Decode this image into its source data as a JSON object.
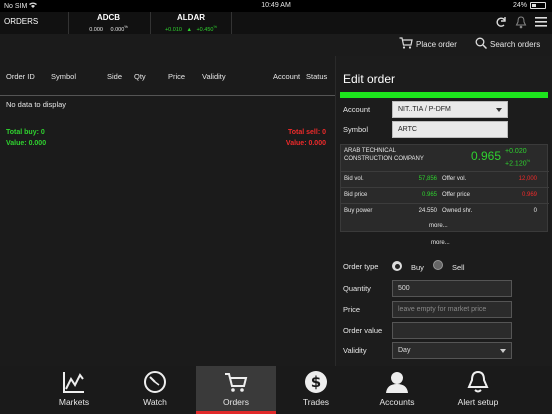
{
  "status": {
    "carrier": "No SIM",
    "time": "10:49 AM",
    "battery": "24%"
  },
  "header": {
    "title": "ORDERS",
    "tickers": [
      {
        "name": "ADCB",
        "v1": "0.000",
        "v2": "0.000",
        "pct": "%"
      },
      {
        "name": "ALDAR",
        "v1": "+0.010",
        "v2": "+0.450",
        "pct": "%"
      }
    ]
  },
  "actions": {
    "place_order": "Place order",
    "search_orders": "Search orders"
  },
  "table": {
    "columns": [
      "Order ID",
      "Symbol",
      "Side",
      "Qty",
      "Price",
      "Validity",
      "Account",
      "Status"
    ],
    "empty": "No data to display"
  },
  "totals": {
    "total_buy": "Total buy: 0",
    "value_buy": "Value: 0.000",
    "total_sell": "Total sell: 0",
    "value_sell": "Value: 0.000"
  },
  "edit": {
    "title": "Edit order",
    "account_label": "Account",
    "account_value": "NIT..TIA  / P-DFM",
    "symbol_label": "Symbol",
    "symbol_value": "ARTC",
    "quote": {
      "company": "ARAB TECHNICAL CONSTRUCTION COMPANY",
      "last": "0.965",
      "change": "+0.020",
      "change_pct": "+2.120",
      "pct": "%",
      "bid_vol_label": "Bid vol.",
      "bid_vol": "57,856",
      "offer_vol_label": "Offer vol.",
      "offer_vol": "12,000",
      "bid_price_label": "Bid price",
      "bid_price": "0.965",
      "offer_price_label": "Offer price",
      "offer_price": "0.969",
      "buy_power_label": "Buy power",
      "buy_power": "24.550",
      "owned_label": "Owned shr.",
      "owned": "0",
      "more1": "more...",
      "more2": "more..."
    },
    "order_type_label": "Order type",
    "buy": "Buy",
    "sell": "Sell",
    "quantity_label": "Quantity",
    "quantity_value": "500",
    "price_label": "Price",
    "price_placeholder": "leave empty for market price",
    "order_value_label": "Order value",
    "validity_label": "Validity",
    "validity_value": "Day"
  },
  "tabs": [
    {
      "label": "Markets",
      "icon": "chart-icon"
    },
    {
      "label": "Watch",
      "icon": "gauge-icon"
    },
    {
      "label": "Orders",
      "icon": "cart-icon"
    },
    {
      "label": "Trades",
      "icon": "dollar-icon"
    },
    {
      "label": "Accounts",
      "icon": "user-icon"
    },
    {
      "label": "Alert setup",
      "icon": "bell-icon"
    }
  ],
  "colors": {
    "accent_green": "#1de41d",
    "up": "#2fd22f",
    "down": "#ee2a2a",
    "active_tab_underline": "#e02a2a"
  }
}
